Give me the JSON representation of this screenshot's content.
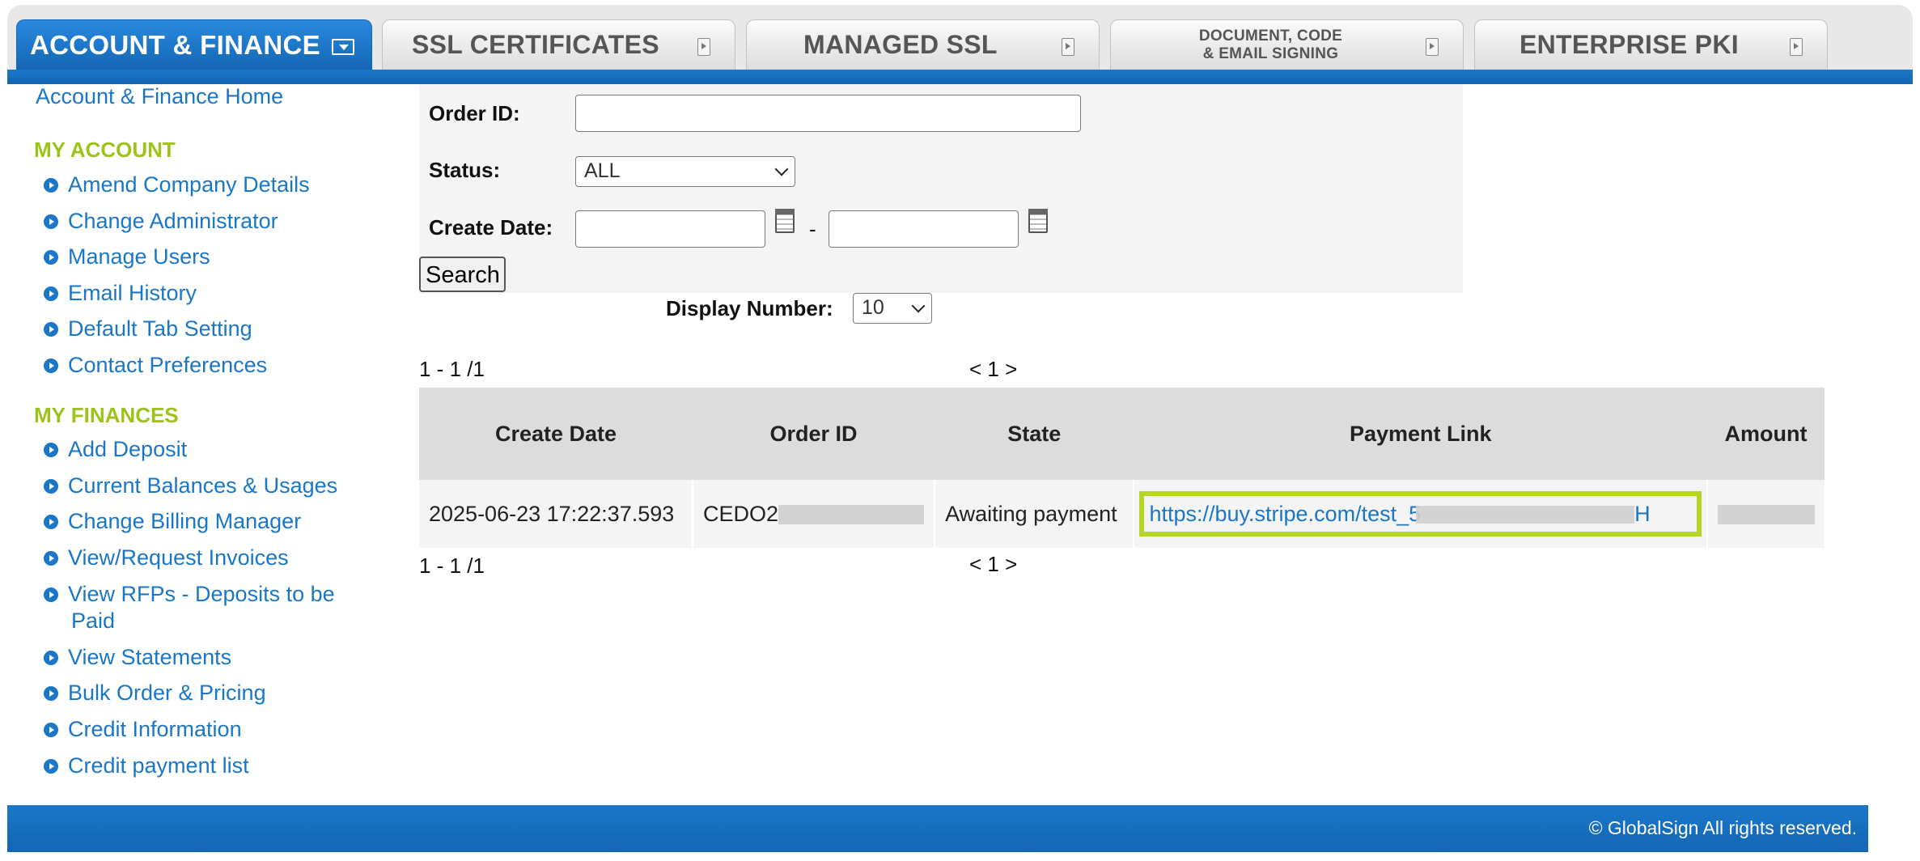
{
  "tabs": [
    {
      "label": "ACCOUNT & FINANCE",
      "active": true
    },
    {
      "label": "SSL CERTIFICATES",
      "active": false
    },
    {
      "label": "MANAGED SSL",
      "active": false
    },
    {
      "label_line1": "DOCUMENT, CODE",
      "label_line2": "& EMAIL SIGNING",
      "active": false
    },
    {
      "label": "ENTERPRISE PKI",
      "active": false
    }
  ],
  "colors": {
    "primary_blue": "#1a76c7",
    "heading_green": "#9dc21a",
    "highlight_green": "#b5d624",
    "table_header_bg": "#dcdcdc",
    "panel_bg": "#f4f4f4"
  },
  "sidebar": {
    "home_label": "Account & Finance Home",
    "my_account_heading": "MY ACCOUNT",
    "my_account_items": [
      "Amend Company Details",
      "Change Administrator",
      "Manage Users",
      "Email History",
      "Default Tab Setting",
      "Contact Preferences"
    ],
    "my_finances_heading": "MY FINANCES",
    "my_finances_items": [
      "Add Deposit",
      "Current Balances & Usages",
      "Change Billing Manager",
      "View/Request Invoices",
      "View RFPs - Deposits to be Paid",
      "View Statements",
      "Bulk Order & Pricing",
      "Credit Information",
      "Credit payment list"
    ],
    "rfp_line1": "View RFPs - Deposits to be",
    "rfp_line2": "Paid"
  },
  "search_form": {
    "order_id_label": "Order ID:",
    "order_id_value": "",
    "status_label": "Status:",
    "status_value": "ALL",
    "create_date_label": "Create Date:",
    "create_date_from": "",
    "create_date_to": "",
    "date_separator": "-",
    "search_button_label": "Search",
    "display_number_label": "Display Number:",
    "display_number_value": "10"
  },
  "pagination": {
    "range_text": "1 - 1 /1",
    "pager_text": "< 1 >"
  },
  "table": {
    "headers": [
      "Create Date",
      "Order ID",
      "State",
      "Payment Link",
      "Amount"
    ],
    "rows": [
      {
        "create_date": "2025-06-23 17:22:37.593",
        "order_id_visible": "CEDO2",
        "state": "Awaiting payment",
        "payment_link_visible": "https://buy.stripe.com/test_5",
        "payment_link_tail": "H"
      }
    ]
  },
  "footer": {
    "copyright": "© GlobalSign All rights reserved."
  },
  "icons": {
    "tab_arrow": "chevron-right-box-icon",
    "active_tab_arrow": "chevron-down-box-icon",
    "sidebar_bullet": "arrow-circle-icon",
    "date_picker": "calendar-icon",
    "select_chevron": "chevron-down-icon"
  }
}
